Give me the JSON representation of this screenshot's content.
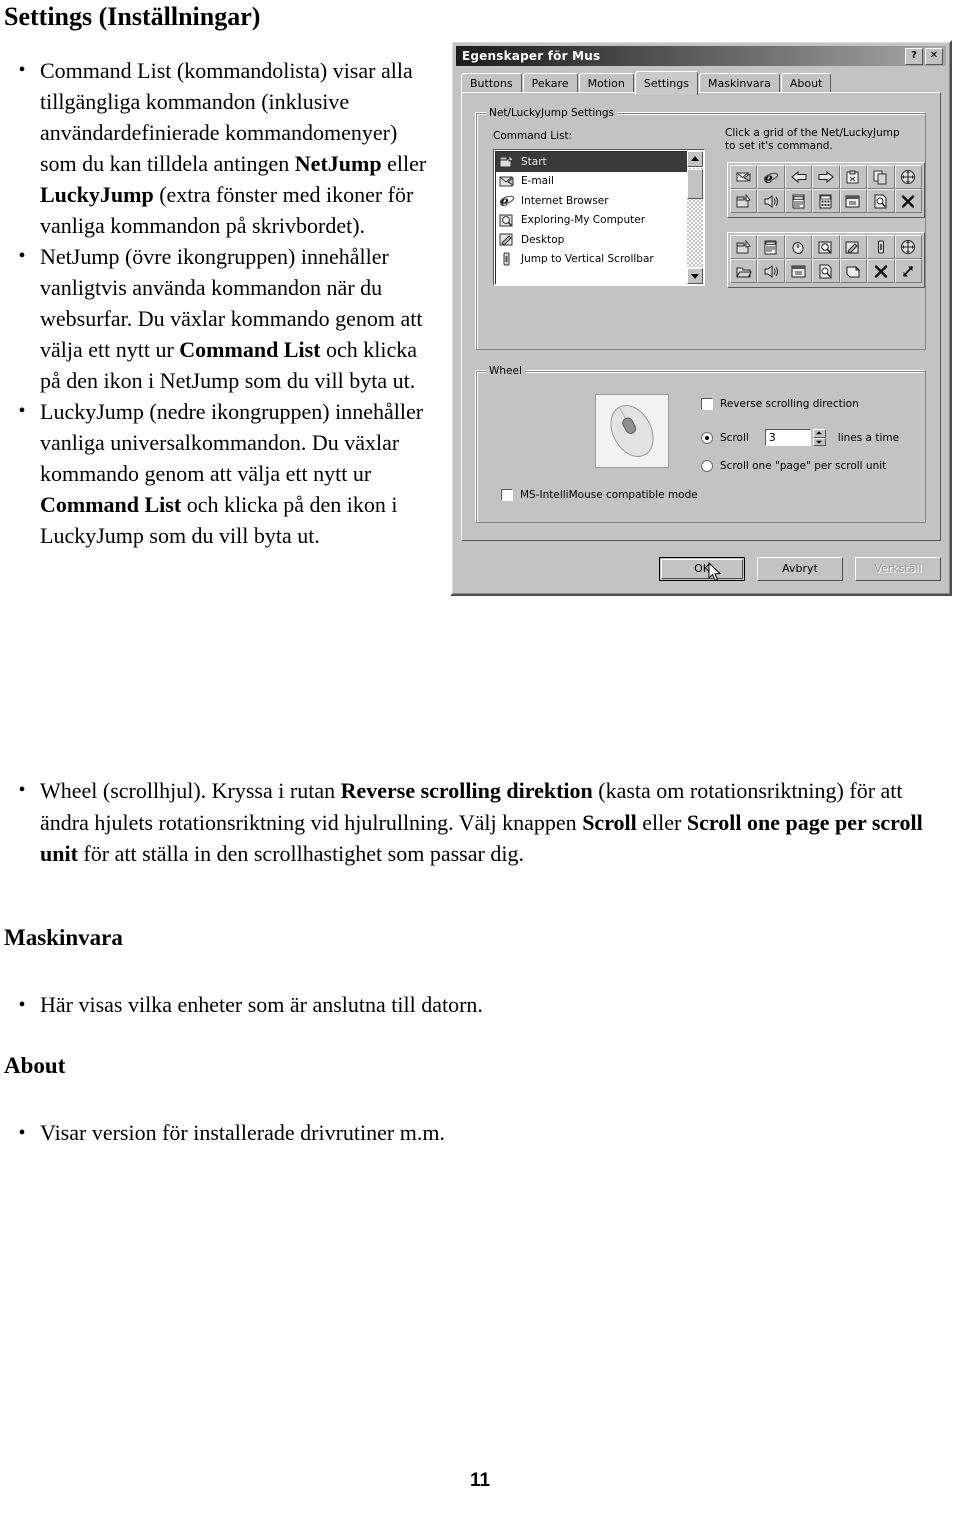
{
  "document": {
    "title": "Settings (Inställningar)",
    "page_number": "11",
    "bullets": [
      {
        "id": "command-list",
        "segments": [
          {
            "t": "Command List (kommandolista) visar alla tillgängliga kommandon (inklusive användardefinierade kommandomenyer) som du kan tilldela antingen ",
            "b": false
          },
          {
            "t": "NetJump",
            "b": true
          },
          {
            "t": " eller ",
            "b": false
          },
          {
            "t": "LuckyJump",
            "b": true
          },
          {
            "t": " (extra fönster med ikoner för vanliga kommandon på skrivbordet).",
            "b": false
          }
        ]
      },
      {
        "id": "netjump",
        "segments": [
          {
            "t": "NetJump (övre ikongruppen) innehåller vanligtvis använda kommandon när du websurfar. Du växlar kommando genom att välja ett nytt ur ",
            "b": false
          },
          {
            "t": "Command List",
            "b": true
          },
          {
            "t": " och klicka på den ikon i NetJump som du vill byta ut.",
            "b": false
          }
        ]
      },
      {
        "id": "luckyjump",
        "segments": [
          {
            "t": "LuckyJump (nedre ikongruppen) innehåller vanliga universalkommandon. Du växlar kommando genom att välja ett nytt ur ",
            "b": false
          },
          {
            "t": "Command List",
            "b": true
          },
          {
            "t": " och klicka på den ikon i LuckyJump som du vill byta ut.",
            "b": false
          }
        ]
      }
    ],
    "wide_bullet": {
      "id": "wheel",
      "segments": [
        {
          "t": "Wheel (scrollhjul). Kryssa i rutan ",
          "b": false
        },
        {
          "t": "Reverse scrolling direktion",
          "b": true
        },
        {
          "t": " (kasta om rotationsriktning) för att ändra hjulets rotationsriktning vid hjulrullning. Välj knappen ",
          "b": false
        },
        {
          "t": "Scroll",
          "b": true
        },
        {
          "t": " eller ",
          "b": false
        },
        {
          "t": "Scroll one page per scroll unit",
          "b": true
        },
        {
          "t": " för att ställa in den scrollhastighet som passar dig.",
          "b": false
        }
      ]
    },
    "sections": [
      {
        "id": "maskinvara",
        "heading": "Maskinvara",
        "bullet": "Här visas vilka enheter som är anslutna till datorn."
      },
      {
        "id": "about",
        "heading": "About",
        "bullet": "Visar version för installerade drivrutiner m.m."
      }
    ]
  },
  "dialog": {
    "title": "Egenskaper för Mus",
    "titlebar_buttons": [
      {
        "name": "help-button",
        "label": "?"
      },
      {
        "name": "close-button",
        "label": "✕"
      }
    ],
    "tabs": [
      {
        "label": "Buttons",
        "active": false
      },
      {
        "label": "Pekare",
        "active": false
      },
      {
        "label": "Motion",
        "active": false
      },
      {
        "label": "Settings",
        "active": true
      },
      {
        "label": "Maskinvara",
        "active": false
      },
      {
        "label": "About",
        "active": false
      }
    ],
    "group_netlucky": {
      "legend": "Net/LuckyJump Settings",
      "list_label": "Command List:",
      "grid_hint_line1": "Click a grid of the Net/LuckyJump",
      "grid_hint_line2": "to set it's command.",
      "command_list": [
        {
          "label": "Start",
          "icon": "start-icon",
          "selected": true
        },
        {
          "label": "E-mail",
          "icon": "mail-icon",
          "selected": false
        },
        {
          "label": "Internet Browser",
          "icon": "ie-icon",
          "selected": false
        },
        {
          "label": "Exploring-My Computer",
          "icon": "explorer-icon",
          "selected": false
        },
        {
          "label": "Desktop",
          "icon": "desktop-icon",
          "selected": false
        },
        {
          "label": "Jump to Vertical Scrollbar",
          "icon": "scrollbar-icon",
          "selected": false
        }
      ],
      "netjump_grid": [
        "mail-icon",
        "ie-icon",
        "back-arrow-icon",
        "forward-arrow-icon",
        "clipboard-icon",
        "copy-icon",
        "move-icon",
        "start-icon",
        "speaker-icon",
        "document-icon",
        "calculator-icon",
        "window-icon",
        "find-icon",
        "close-x-icon"
      ],
      "luckyjump_grid": [
        "start-icon",
        "menu-icon",
        "mouse-icon",
        "find-icon",
        "desktop-icon",
        "scrollbar-icon",
        "move-icon",
        "folder-icon",
        "speaker-icon",
        "window-icon",
        "find-icon",
        "page-icon",
        "close-x-icon",
        "resize-icon"
      ]
    },
    "group_wheel": {
      "legend": "Wheel",
      "reverse_checkbox": {
        "label": "Reverse scrolling direction",
        "checked": false
      },
      "scroll_radio": {
        "label": "Scroll",
        "checked": true
      },
      "scroll_lines_value": "3",
      "lines_suffix": "lines a time",
      "page_radio": {
        "label": "Scroll one \"page\" per scroll unit",
        "checked": false
      },
      "intellimouse_checkbox": {
        "label": "MS-IntelliMouse compatible mode",
        "checked": false
      }
    },
    "buttons": [
      {
        "label": "OK",
        "state": "default"
      },
      {
        "label": "Avbryt",
        "state": "normal"
      },
      {
        "label": "Verkställ",
        "state": "disabled"
      }
    ]
  }
}
